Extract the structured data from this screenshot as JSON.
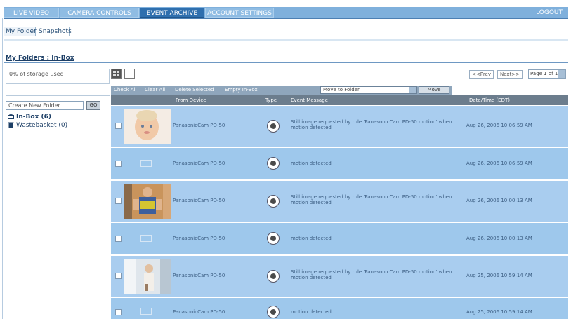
{
  "nav": {
    "tabs": [
      {
        "label": "LIVE VIDEO"
      },
      {
        "label": "CAMERA CONTROLS"
      },
      {
        "label": "EVENT ARCHIVE"
      },
      {
        "label": "ACCOUNT SETTINGS"
      }
    ],
    "logout": "LOGOUT"
  },
  "subtabs": [
    {
      "label": "My Folders"
    },
    {
      "label": "Snapshots"
    }
  ],
  "heading": "My Folders : In-Box",
  "sidebar": {
    "storage_text": "0% of storage used",
    "create_placeholder": "Create New Folder",
    "create_button": "GO",
    "folders": [
      {
        "label": "In-Box (6)"
      },
      {
        "label": "Wastebasket (0)"
      }
    ]
  },
  "pager": {
    "prev": "<<Prev",
    "next": "Next>>",
    "page_select": "Page 1 of 1"
  },
  "actions": {
    "check_all": "Check All",
    "clear_all": "Clear All",
    "delete_selected": "Delete Selected",
    "empty_inbox": "Empty In-Box",
    "move_select": "Move to Folder",
    "move_button": "Move"
  },
  "table": {
    "headers": {
      "from": "From Device",
      "type": "Type",
      "message": "Event Message",
      "date": "Date/Time (EDT)"
    },
    "rows": [
      {
        "device": "PanasonicCam PD-50",
        "message": "Still image requested by rule 'PanasonicCam PD-50 motion' when motion detected",
        "date": "Aug 26, 2006 10:06:59 AM"
      },
      {
        "device": "PanasonicCam PD-50",
        "message": "motion detected",
        "date": "Aug 26, 2006 10:06:59 AM"
      },
      {
        "device": "PanasonicCam PD-50",
        "message": "Still image requested by rule 'PanasonicCam PD-50 motion' when motion detected",
        "date": "Aug 26, 2006 10:00:13 AM"
      },
      {
        "device": "PanasonicCam PD-50",
        "message": "motion detected",
        "date": "Aug 26, 2006 10:00:13 AM"
      },
      {
        "device": "PanasonicCam PD-50",
        "message": "Still image requested by rule 'PanasonicCam PD-50 motion' when motion detected",
        "date": "Aug 25, 2006 10:59:14 AM"
      },
      {
        "device": "PanasonicCam PD-50",
        "message": "motion detected",
        "date": "Aug 25, 2006 10:59:14 AM"
      }
    ]
  }
}
